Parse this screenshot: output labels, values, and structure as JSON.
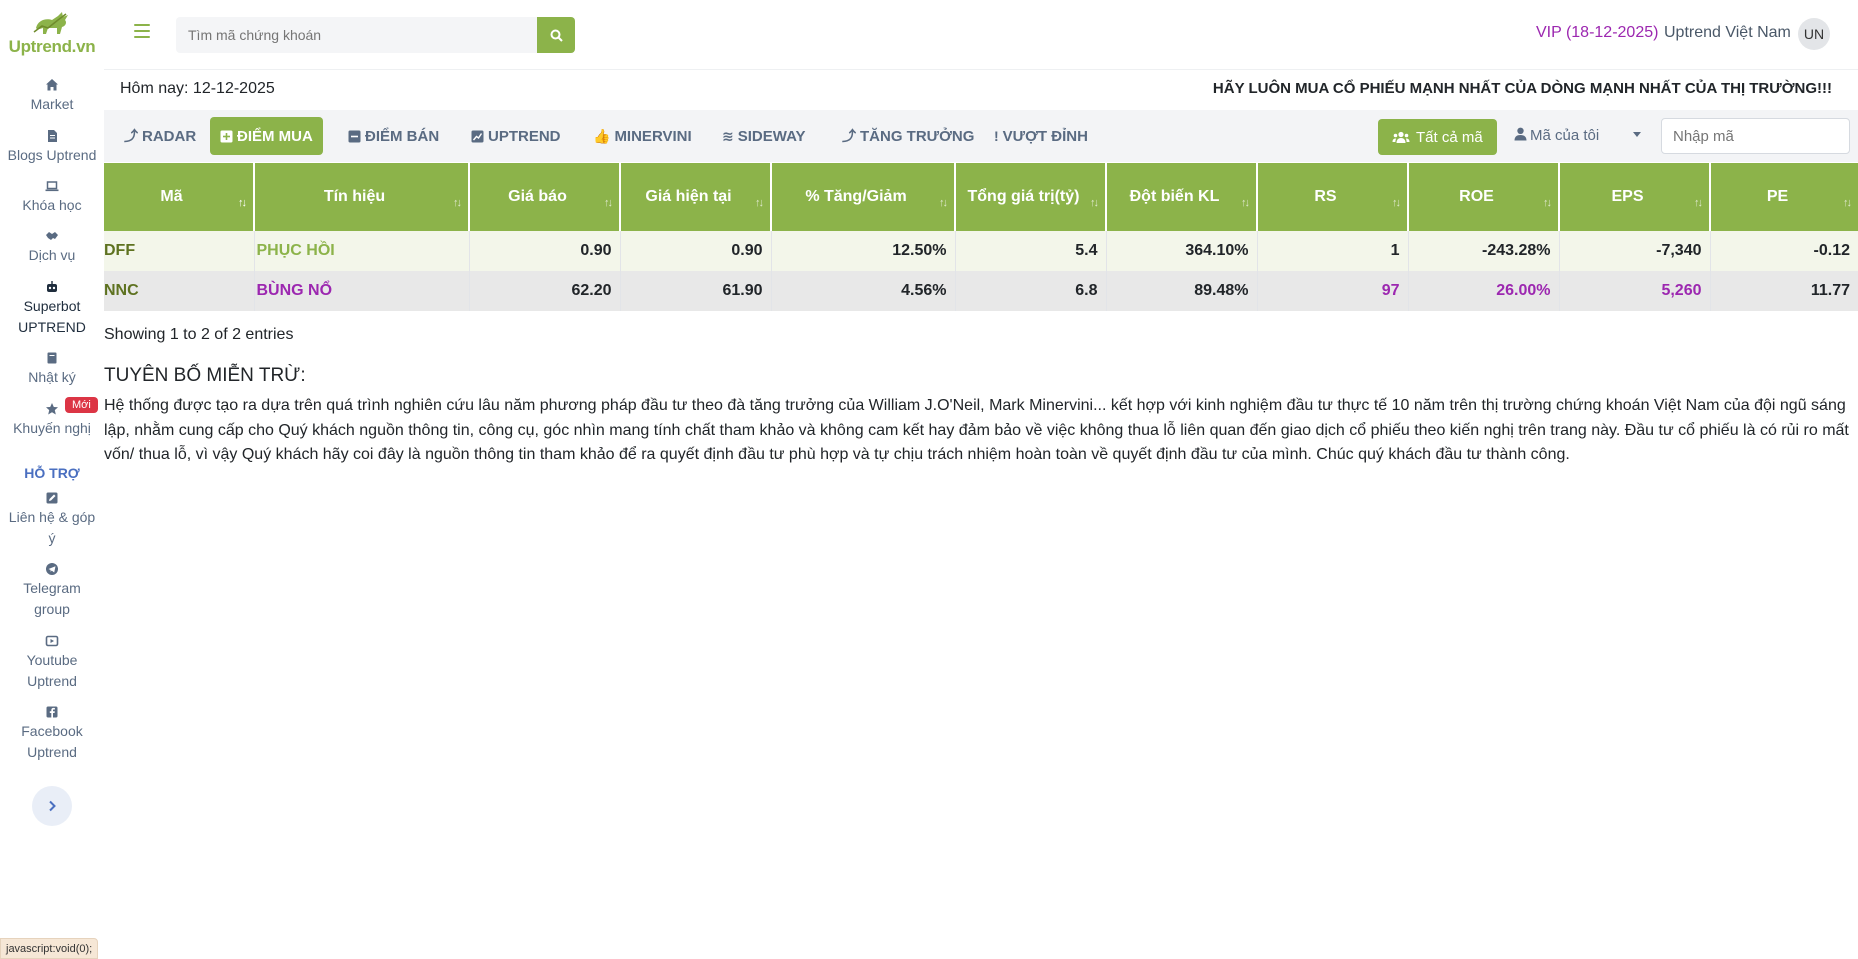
{
  "brand": {
    "logo_text": "Uptrend.vn",
    "accent": "#8cb34a"
  },
  "sidebar": {
    "items": [
      {
        "label": "Market",
        "icon": "home-icon"
      },
      {
        "label": "Blogs Uptrend",
        "icon": "file-icon"
      },
      {
        "label": "Khóa học",
        "icon": "laptop-icon"
      },
      {
        "label": "Dịch vụ",
        "icon": "handshake-icon"
      },
      {
        "label_line1": "Superbot",
        "label_line2": "UPTREND",
        "icon": "robot-icon"
      },
      {
        "label": "Nhật ký",
        "icon": "book-icon"
      },
      {
        "label": "Khuyến nghị",
        "icon": "star-icon",
        "badge": "Mới"
      }
    ],
    "support_heading": "HỖ TRỢ",
    "support_items": [
      {
        "label_line1": "Liên hệ & góp",
        "label_line2": "ý",
        "icon": "edit-icon"
      },
      {
        "label_line1": "Telegram",
        "label_line2": "group",
        "icon": "telegram-icon"
      },
      {
        "label_line1": "Youtube",
        "label_line2": "Uptrend",
        "icon": "youtube-icon"
      },
      {
        "label_line1": "Facebook",
        "label_line2": "Uptrend",
        "icon": "facebook-icon"
      }
    ],
    "expand_icon": "chevron-right-icon"
  },
  "header": {
    "search_placeholder": "Tìm mã chứng khoán",
    "vip": "VIP (18-12-2025)",
    "user_name": "Uptrend Việt Nam",
    "avatar": "UN"
  },
  "info": {
    "today": "Hôm nay: 12-12-2025",
    "slogan": "HÃY LUÔN MUA CỔ PHIẾU MẠNH NHẤT CỦA DÒNG MẠNH NHẤT CỦA THỊ TRƯỜNG!!!"
  },
  "tabs": [
    {
      "label": "RADAR",
      "icon": "arrow-up-icon"
    },
    {
      "label": "ĐIỂM MUA",
      "icon": "plus-square-icon",
      "active": true
    },
    {
      "label": "ĐIỂM BÁN",
      "icon": "minus-square-icon"
    },
    {
      "label": "UPTREND",
      "icon": "chart-icon"
    },
    {
      "label": "MINERVINI",
      "icon": "thumbs-up-icon"
    },
    {
      "label": "SIDEWAY",
      "icon": "waves-icon"
    },
    {
      "label": "TĂNG TRƯỞNG",
      "icon": "arrow-up-icon"
    },
    {
      "label": "VƯỢT ĐỈNH",
      "icon": "exclamation-icon"
    }
  ],
  "toolbar": {
    "all_codes": "Tất cả mã",
    "my_codes": "Mã của tôi",
    "code_input_placeholder": "Nhập mã"
  },
  "table": {
    "columns": [
      "Mã",
      "Tín hiệu",
      "Giá báo",
      "Giá hiện tại",
      "% Tăng/Giảm",
      "Tổng giá trị(tỷ)",
      "Đột biến KL",
      "RS",
      "ROE",
      "EPS",
      "PE"
    ],
    "rows": [
      {
        "code": "DFF",
        "signal": "PHỤC HỒI",
        "alert_price": "0.90",
        "current_price": "0.90",
        "change": "12.50%",
        "total_value": "5.4",
        "volume_spike": "364.10%",
        "rs": "1",
        "roe": "-243.28%",
        "eps": "-7,340",
        "pe": "-0.12"
      },
      {
        "code": "NNC",
        "signal": "BÙNG NỔ",
        "alert_price": "62.20",
        "current_price": "61.90",
        "change": "4.56%",
        "total_value": "6.8",
        "volume_spike": "89.48%",
        "rs": "97",
        "roe": "26.00%",
        "eps": "5,260",
        "pe": "11.77"
      }
    ],
    "showing": "Showing 1 to 2 of 2 entries"
  },
  "disclaimer": {
    "title": "TUYÊN BỐ MIỄN TRỪ:",
    "text": "Hệ thống được tạo ra dựa trên quá trình nghiên cứu lâu năm phương pháp đầu tư theo đà tăng trưởng của William J.O'Neil, Mark Minervini... kết hợp với kinh nghiệm đầu tư thực tế 10 năm trên thị trường chứng khoán Việt Nam của đội ngũ sáng lập, nhằm cung cấp cho Quý khách nguồn thông tin, công cụ, góc nhìn mang tính chất tham khảo và không cam kết hay đảm bảo về việc không thua lỗ liên quan đến giao dịch cổ phiếu theo kiến nghị trên trang này. Đầu tư cổ phiếu là có rủi ro mất vốn/ thua lỗ, vì vậy Quý khách hãy coi đây là nguồn thông tin tham khảo để ra quyết định đầu tư phù hợp và tự chịu trách nhiệm hoàn toàn về quyết định đầu tư của mình. Chúc quý khách đầu tư thành công."
  },
  "statusbar": "javascript:void(0);"
}
